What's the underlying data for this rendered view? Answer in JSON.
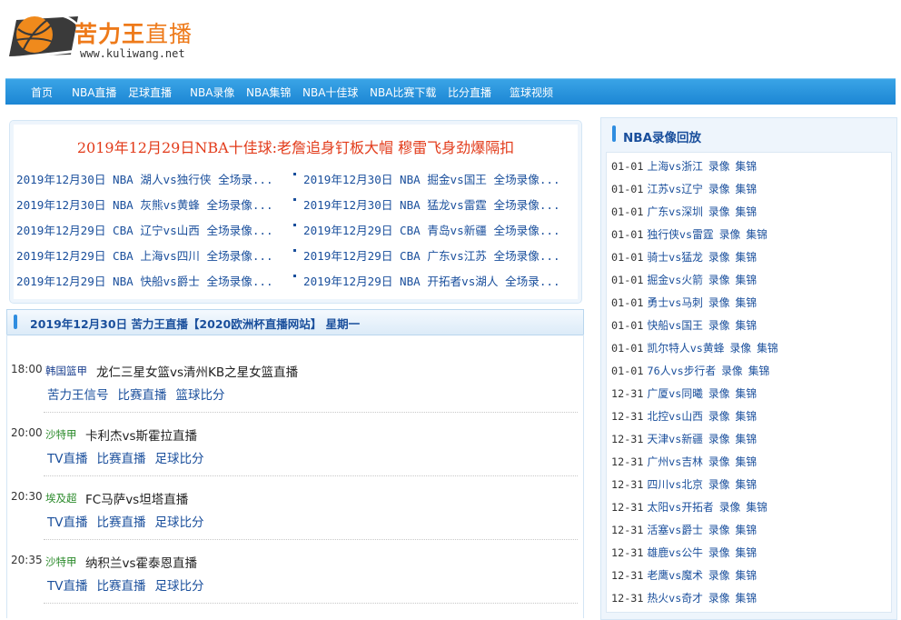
{
  "header": {
    "site_name_bold": "苦力王",
    "site_name_rest": "直播",
    "site_url": "www.kuliwang.net"
  },
  "nav": {
    "items": [
      "首页",
      "NBA直播",
      "足球直播",
      "NBA录像",
      "NBA集锦",
      "NBA十佳球",
      "NBA比赛下载",
      "比分直播",
      "篮球视频"
    ]
  },
  "headline": {
    "title": "2019年12月29日NBA十佳球:老詹追身钉板大帽 穆雷飞身劲爆隔扣",
    "links_left": [
      "2019年12月30日 NBA 湖人vs独行侠 全场录...",
      "2019年12月30日 NBA 灰熊vs黄蜂 全场录像...",
      "2019年12月29日 CBA 辽宁vs山西 全场录像...",
      "2019年12月29日 CBA 上海vs四川 全场录像...",
      "2019年12月29日 NBA 快船vs爵士 全场录像..."
    ],
    "links_right": [
      "2019年12月30日 NBA 掘金vs国王 全场录像...",
      "2019年12月30日 NBA 猛龙vs雷霆 全场录像...",
      "2019年12月29日 CBA 青岛vs新疆 全场录像...",
      "2019年12月29日 CBA 广东vs江苏 全场录像...",
      "2019年12月29日 NBA 开拓者vs湖人 全场录..."
    ]
  },
  "day_header": "2019年12月30日 苦力王直播【2020欧洲杯直播网站】 星期一",
  "matches": [
    {
      "time": "18:00",
      "league": "韩国篮甲",
      "league_color": "#1a3f8f",
      "title": "龙仁三星女篮vs清州KB之星女篮直播",
      "links": [
        "苦力王信号",
        "比赛直播",
        "篮球比分"
      ]
    },
    {
      "time": "20:00",
      "league": "沙特甲",
      "league_color": "#2a8a2a",
      "title": "卡利杰vs斯霍拉直播",
      "links": [
        "TV直播",
        "比赛直播",
        "足球比分"
      ]
    },
    {
      "time": "20:30",
      "league": "埃及超",
      "league_color": "#2a8a2a",
      "title": "FC马萨vs坦塔直播",
      "links": [
        "TV直播",
        "比赛直播",
        "足球比分"
      ]
    },
    {
      "time": "20:35",
      "league": "沙特甲",
      "league_color": "#2a8a2a",
      "title": "纳积兰vs霍泰恩直播",
      "links": [
        "TV直播",
        "比赛直播",
        "足球比分"
      ]
    }
  ],
  "replay": {
    "title": "NBA录像回放",
    "rows": [
      {
        "date": "01-01",
        "teams": "上海vs浙江",
        "a": "录像",
        "b": "集锦"
      },
      {
        "date": "01-01",
        "teams": "江苏vs辽宁",
        "a": "录像",
        "b": "集锦"
      },
      {
        "date": "01-01",
        "teams": "广东vs深圳",
        "a": "录像",
        "b": "集锦"
      },
      {
        "date": "01-01",
        "teams": "独行侠vs雷霆",
        "a": "录像",
        "b": "集锦"
      },
      {
        "date": "01-01",
        "teams": "骑士vs猛龙",
        "a": "录像",
        "b": "集锦"
      },
      {
        "date": "01-01",
        "teams": "掘金vs火箭",
        "a": "录像",
        "b": "集锦"
      },
      {
        "date": "01-01",
        "teams": "勇士vs马刺",
        "a": "录像",
        "b": "集锦"
      },
      {
        "date": "01-01",
        "teams": "快船vs国王",
        "a": "录像",
        "b": "集锦"
      },
      {
        "date": "01-01",
        "teams": "凯尔特人vs黄蜂",
        "a": "录像",
        "b": "集锦"
      },
      {
        "date": "01-01",
        "teams": "76人vs步行者",
        "a": "录像",
        "b": "集锦"
      },
      {
        "date": "12-31",
        "teams": "广厦vs同曦",
        "a": "录像",
        "b": "集锦"
      },
      {
        "date": "12-31",
        "teams": "北控vs山西",
        "a": "录像",
        "b": "集锦"
      },
      {
        "date": "12-31",
        "teams": "天津vs新疆",
        "a": "录像",
        "b": "集锦"
      },
      {
        "date": "12-31",
        "teams": "广州vs吉林",
        "a": "录像",
        "b": "集锦"
      },
      {
        "date": "12-31",
        "teams": "四川vs北京",
        "a": "录像",
        "b": "集锦"
      },
      {
        "date": "12-31",
        "teams": "太阳vs开拓者",
        "a": "录像",
        "b": "集锦"
      },
      {
        "date": "12-31",
        "teams": "活塞vs爵士",
        "a": "录像",
        "b": "集锦"
      },
      {
        "date": "12-31",
        "teams": "雄鹿vs公牛",
        "a": "录像",
        "b": "集锦"
      },
      {
        "date": "12-31",
        "teams": "老鹰vs魔术",
        "a": "录像",
        "b": "集锦"
      },
      {
        "date": "12-31",
        "teams": "热火vs奇才",
        "a": "录像",
        "b": "集锦"
      }
    ]
  }
}
